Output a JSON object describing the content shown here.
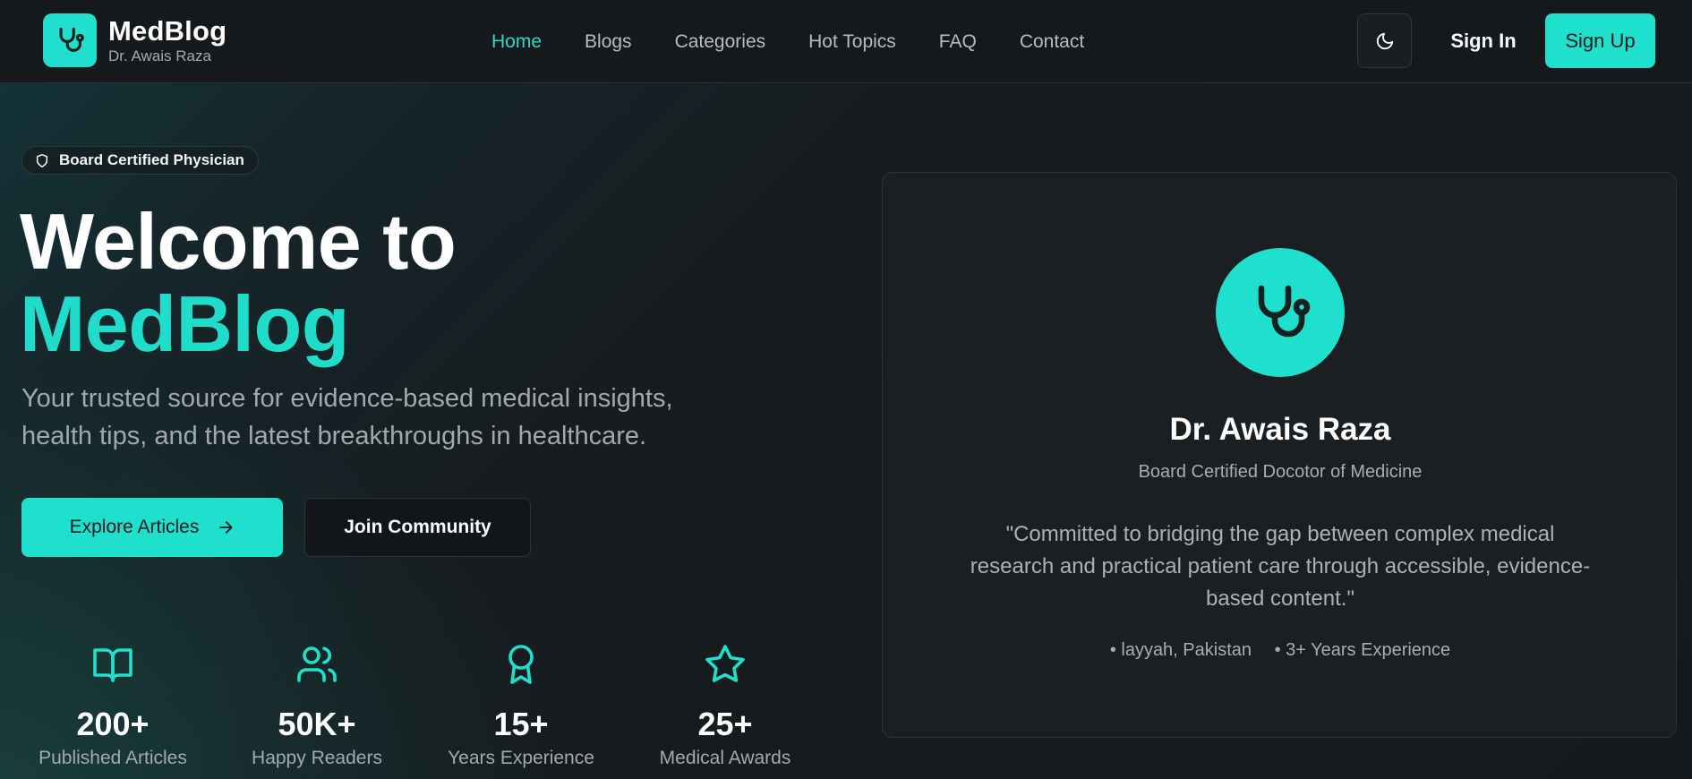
{
  "brand": {
    "name": "MedBlog",
    "subtitle": "Dr. Awais Raza"
  },
  "nav": {
    "items": [
      {
        "label": "Home",
        "active": true
      },
      {
        "label": "Blogs",
        "active": false
      },
      {
        "label": "Categories",
        "active": false
      },
      {
        "label": "Hot Topics",
        "active": false
      },
      {
        "label": "FAQ",
        "active": false
      },
      {
        "label": "Contact",
        "active": false
      }
    ]
  },
  "header_actions": {
    "theme_icon": "moon-icon",
    "signin_label": "Sign In",
    "signup_label": "Sign Up"
  },
  "hero": {
    "badge": "Board Certified Physician",
    "title_line1": "Welcome to",
    "title_line2": "MedBlog",
    "description": "Your trusted source for evidence-based medical insights, health tips, and the latest breakthroughs in healthcare.",
    "primary_button": "Explore Articles",
    "secondary_button": "Join Community"
  },
  "stats": [
    {
      "icon": "book-open-icon",
      "value": "200+",
      "label": "Published Articles"
    },
    {
      "icon": "users-icon",
      "value": "50K+",
      "label": "Happy Readers"
    },
    {
      "icon": "award-icon",
      "value": "15+",
      "label": "Years Experience"
    },
    {
      "icon": "star-icon",
      "value": "25+",
      "label": "Medical Awards"
    }
  ],
  "profile": {
    "icon": "stethoscope-icon",
    "name": "Dr. Awais Raza",
    "title": "Board Certified Docotor of Medicine",
    "quote": "\"Committed to bridging the gap between complex medical research and practical patient care through accessible, evidence-based content.\"",
    "location": "• layyah, Pakistan",
    "experience": "• 3+ Years Experience"
  },
  "colors": {
    "accent": "#1ee0cd",
    "background": "#14181b",
    "card": "#1b1f22"
  }
}
